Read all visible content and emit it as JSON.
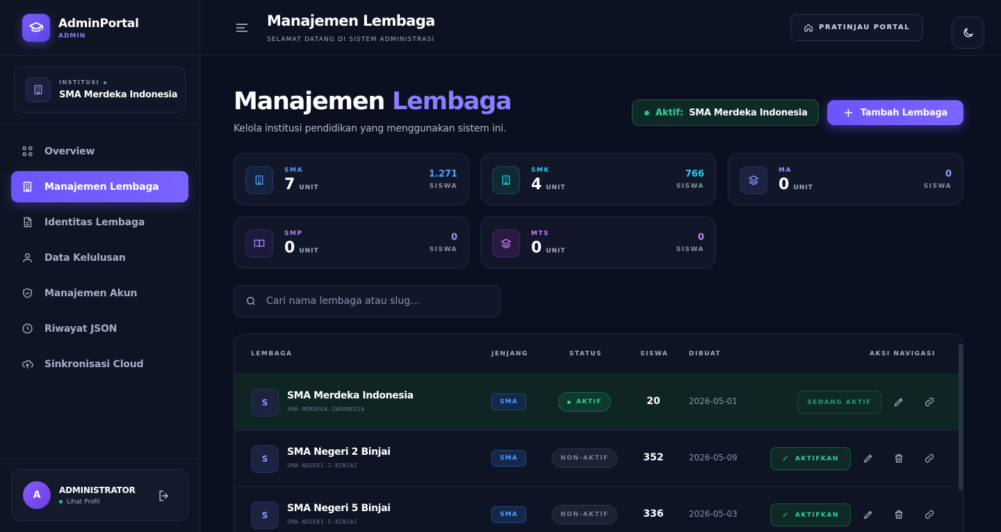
{
  "brand": {
    "title": "AdminPortal",
    "subtitle": "ADMIN"
  },
  "institution": {
    "label": "INSTITUSI",
    "name": "SMA Merdeka Indonesia"
  },
  "sidebar": {
    "items": [
      {
        "label": "Overview",
        "icon": "grid-icon"
      },
      {
        "label": "Manajemen Lembaga",
        "icon": "building-icon",
        "active": true
      },
      {
        "label": "Identitas Lembaga",
        "icon": "document-icon"
      },
      {
        "label": "Data Kelulusan",
        "icon": "users-icon"
      },
      {
        "label": "Manajemen Akun",
        "icon": "shield-icon"
      },
      {
        "label": "Riwayat JSON",
        "icon": "clock-icon"
      },
      {
        "label": "Sinkronisasi Cloud",
        "icon": "cloud-upload-icon"
      }
    ]
  },
  "user": {
    "initial": "A",
    "name": "ADMINISTRATOR",
    "profile_link": "Lihat Profil"
  },
  "header": {
    "title": "Manajemen Lembaga",
    "subtitle": "SELAMAT DATANG DI SISTEM ADMINISTRASI",
    "preview_label": "PRATINJAU PORTAL"
  },
  "main": {
    "title_part1": "Manajemen",
    "title_part2": "Lembaga",
    "description": "Kelola institusi pendidikan yang menggunakan sistem ini.",
    "active_key": "Aktif:",
    "active_value": "SMA Merdeka Indonesia",
    "add_label": "Tambah Lembaga"
  },
  "stats": [
    {
      "key": "SMA",
      "units": "7",
      "unit_label": "UNIT",
      "count": "1.271",
      "count_label": "SISWA",
      "color": "#4ea2ff"
    },
    {
      "key": "SMK",
      "units": "4",
      "unit_label": "UNIT",
      "count": "766",
      "count_label": "SISWA",
      "color": "#22d3ee"
    },
    {
      "key": "MA",
      "units": "0",
      "unit_label": "UNIT",
      "count": "0",
      "count_label": "SISWA",
      "color": "#8b9bff"
    },
    {
      "key": "SMP",
      "units": "0",
      "unit_label": "UNIT",
      "count": "0",
      "count_label": "SISWA",
      "color": "#a78bfa"
    },
    {
      "key": "MTS",
      "units": "0",
      "unit_label": "UNIT",
      "count": "0",
      "count_label": "SISWA",
      "color": "#c084fc"
    }
  ],
  "search": {
    "placeholder": "Cari nama lembaga atau slug..."
  },
  "table": {
    "headers": {
      "lembaga": "LEMBAGA",
      "jenjang": "JENJANG",
      "status": "STATUS",
      "siswa": "SISWA",
      "dibuat": "DIBUAT",
      "aksi": "AKSI NAVIGASI"
    },
    "rows": [
      {
        "initial": "S",
        "name": "SMA Merdeka Indonesia",
        "slug": "SMA-MERDEKA-INDONESIA",
        "jenjang": "SMA",
        "status": "AKTIF",
        "siswa": "20",
        "dibuat": "2026-05-01",
        "action": "SEDANG AKTIF"
      },
      {
        "initial": "S",
        "name": "SMA Negeri 2 Binjai",
        "slug": "SMA-NEGERI-2-BINJAI",
        "jenjang": "SMA",
        "status": "NON-AKTIF",
        "siswa": "352",
        "dibuat": "2026-05-09",
        "action": "AKTIFKAN"
      },
      {
        "initial": "S",
        "name": "SMA Negeri 5 Binjai",
        "slug": "SMA-NEGERI-5-BINJAI",
        "jenjang": "SMA",
        "status": "NON-AKTIF",
        "siswa": "336",
        "dibuat": "2026-05-03",
        "action": "AKTIFKAN"
      }
    ]
  }
}
